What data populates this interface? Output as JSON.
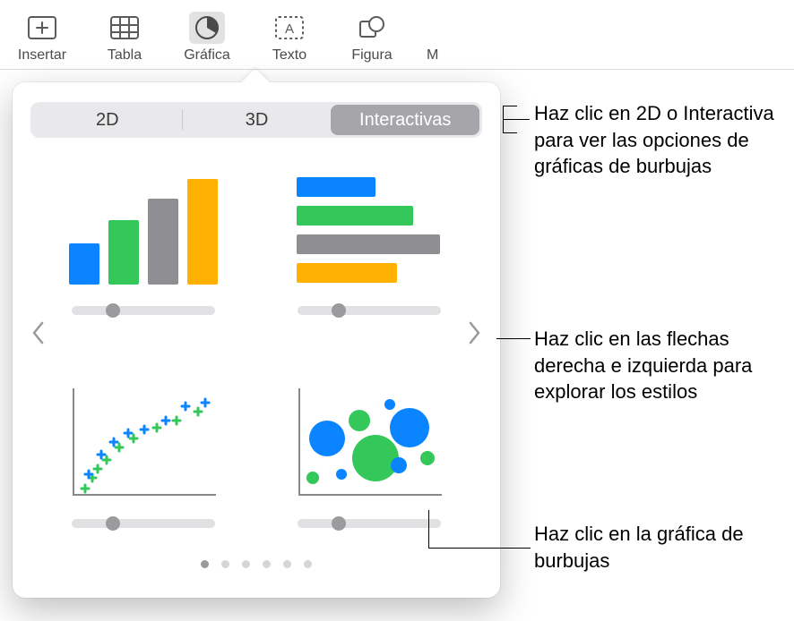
{
  "toolbar": {
    "insert": "Insertar",
    "table": "Tabla",
    "chart": "Gráfica",
    "text": "Texto",
    "shape": "Figura",
    "extra": "M"
  },
  "tabs": {
    "twoD": "2D",
    "threeD": "3D",
    "interactive": "Interactivas"
  },
  "callouts": {
    "tabs": "Haz clic en 2D o Interactiva para ver las opciones de gráficas de burbujas",
    "arrows": "Haz clic en las flechas derecha e izquierda para explorar los estilos",
    "bubble": "Haz clic en la gráfica de burbujas"
  },
  "colors": {
    "blue": "#0A84FF",
    "green": "#34C759",
    "gray": "#8E8E93",
    "orange": "#FFB000"
  }
}
